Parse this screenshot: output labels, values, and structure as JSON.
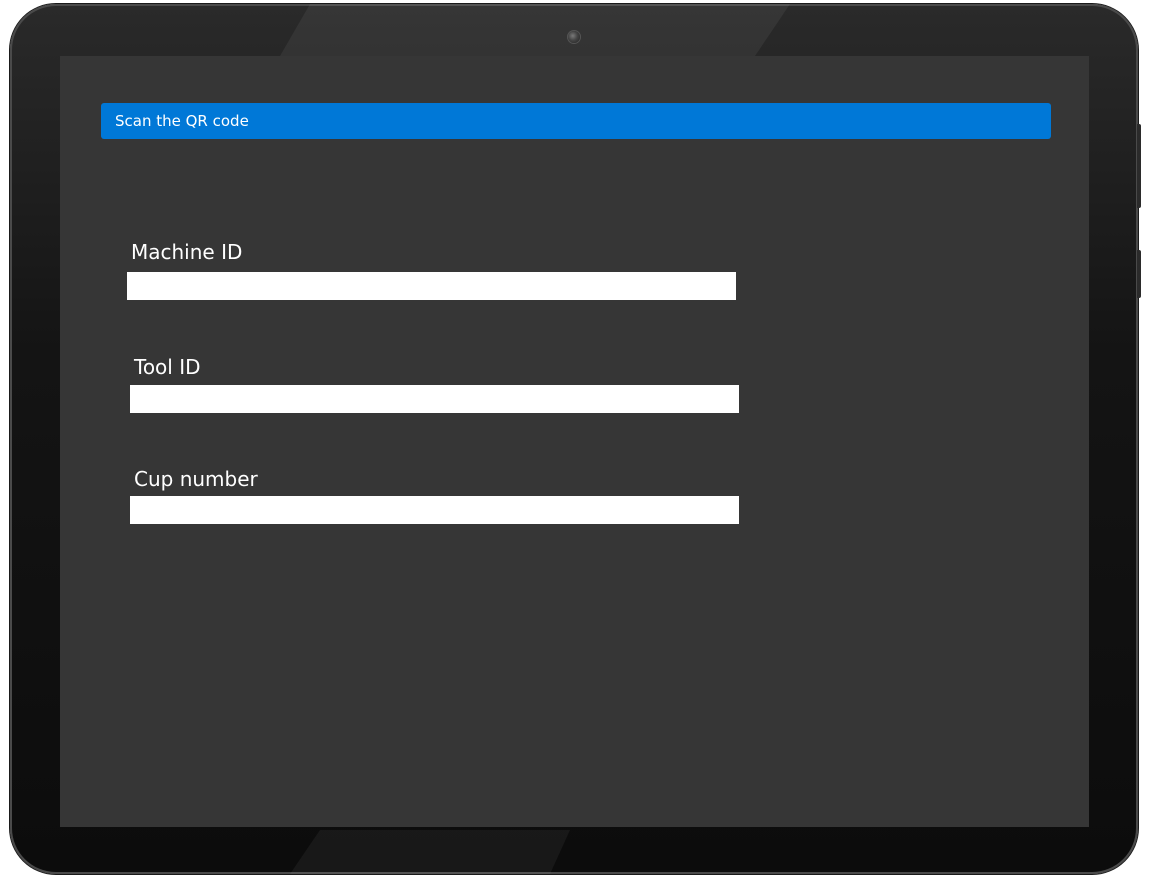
{
  "banner": {
    "text": "Scan the QR code",
    "color": "#0078d7"
  },
  "form": {
    "fields": [
      {
        "label": "Machine ID",
        "value": "",
        "placeholder": ""
      },
      {
        "label": "Tool ID",
        "value": "",
        "placeholder": ""
      },
      {
        "label": "Cup number",
        "value": "",
        "placeholder": ""
      }
    ]
  },
  "theme": {
    "screen_background": "#363636",
    "input_background": "#ffffff",
    "text_color": "#ffffff"
  },
  "icons": {
    "camera": "camera-lens-icon"
  }
}
